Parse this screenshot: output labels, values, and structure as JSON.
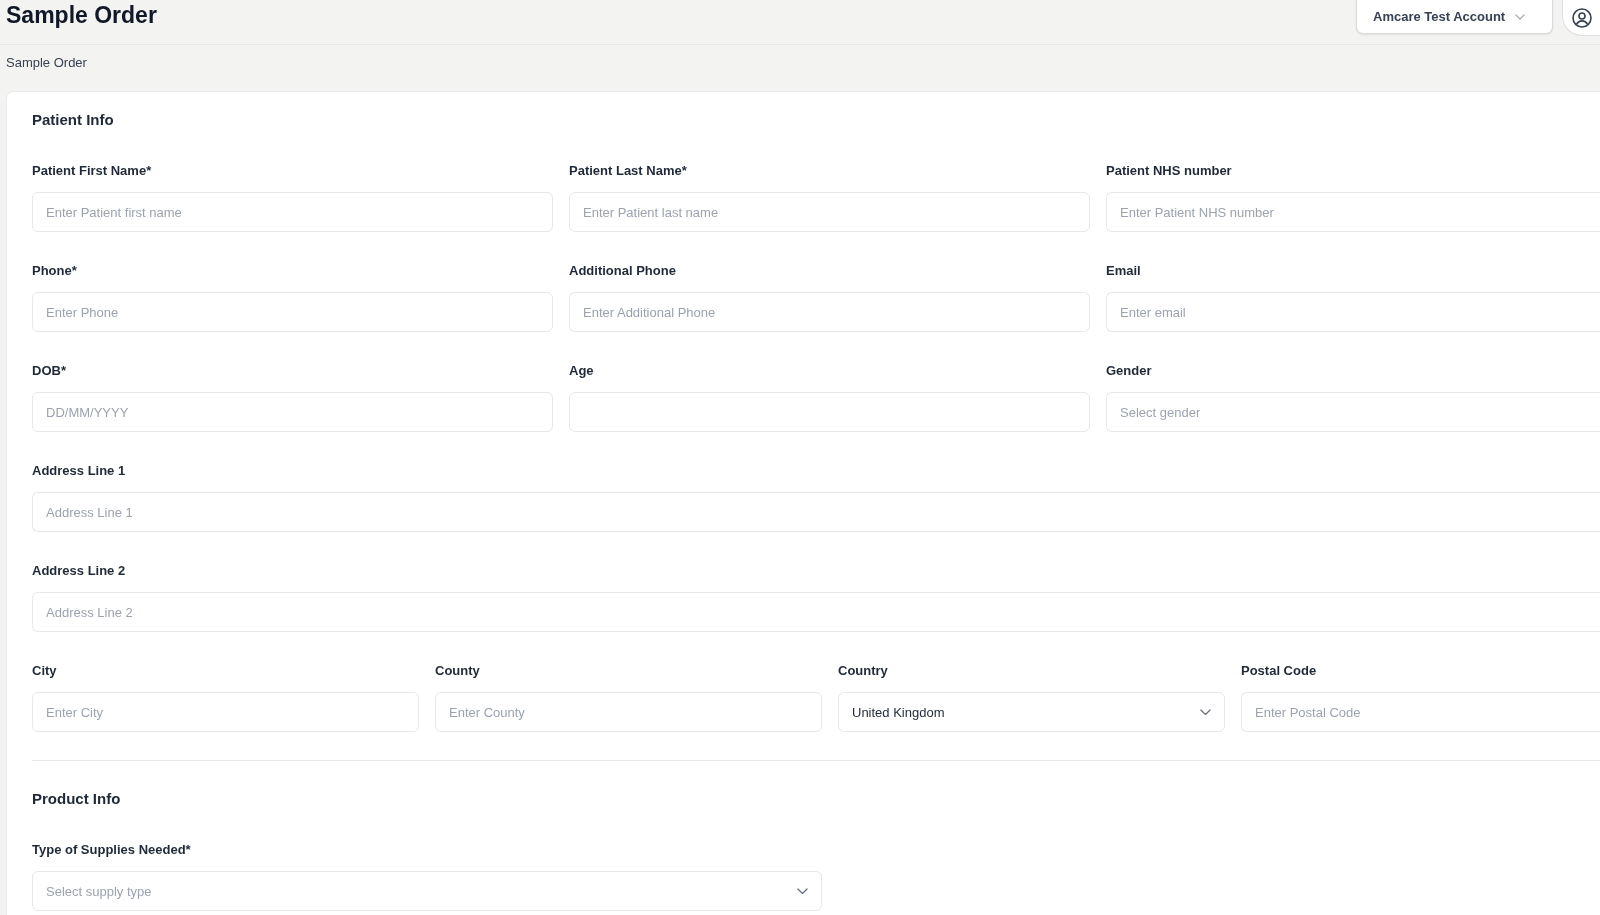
{
  "header": {
    "title": "Sample Order",
    "account": {
      "label": "Amcare Test Account"
    }
  },
  "breadcrumb": [
    "Sample Order"
  ],
  "sections": [
    {
      "title": "Patient Info",
      "rows": [
        {
          "fields": [
            {
              "kind": "text",
              "label": "Patient First Name*",
              "placeholder": "Enter Patient first name"
            },
            {
              "kind": "text",
              "label": "Patient Last Name*",
              "placeholder": "Enter Patient last name"
            },
            {
              "kind": "text",
              "label": "Patient NHS number",
              "placeholder": "Enter Patient NHS number"
            }
          ]
        },
        {
          "fields": [
            {
              "kind": "text",
              "label": "Phone*",
              "placeholder": "Enter Phone"
            },
            {
              "kind": "text",
              "label": "Additional Phone",
              "placeholder": "Enter Additional Phone"
            },
            {
              "kind": "text",
              "label": "Email",
              "placeholder": "Enter email"
            }
          ]
        },
        {
          "fields": [
            {
              "kind": "date",
              "label": "DOB*",
              "placeholder": "DD/MM/YYYY"
            },
            {
              "kind": "text",
              "label": "Age"
            },
            {
              "kind": "select",
              "label": "Gender",
              "placeholder": "Select gender"
            }
          ]
        },
        {
          "fields": [
            {
              "kind": "text",
              "label": "Address Line 1",
              "placeholder": "Address Line 1"
            }
          ]
        },
        {
          "fields": [
            {
              "kind": "text",
              "label": "Address Line 2",
              "placeholder": "Address Line 2"
            }
          ]
        },
        {
          "fields": [
            {
              "kind": "text",
              "label": "City",
              "placeholder": "Enter City"
            },
            {
              "kind": "text",
              "label": "County",
              "placeholder": "Enter County"
            },
            {
              "kind": "select",
              "label": "Country",
              "value": "United Kingdom"
            },
            {
              "kind": "text",
              "label": "Postal Code",
              "placeholder": "Enter Postal Code"
            }
          ]
        }
      ]
    },
    {
      "title": "Product Info",
      "rows": [
        {
          "fields": [
            {
              "kind": "select",
              "label": "Type of Supplies Needed*",
              "placeholder": "Select supply type"
            }
          ]
        }
      ]
    }
  ]
}
